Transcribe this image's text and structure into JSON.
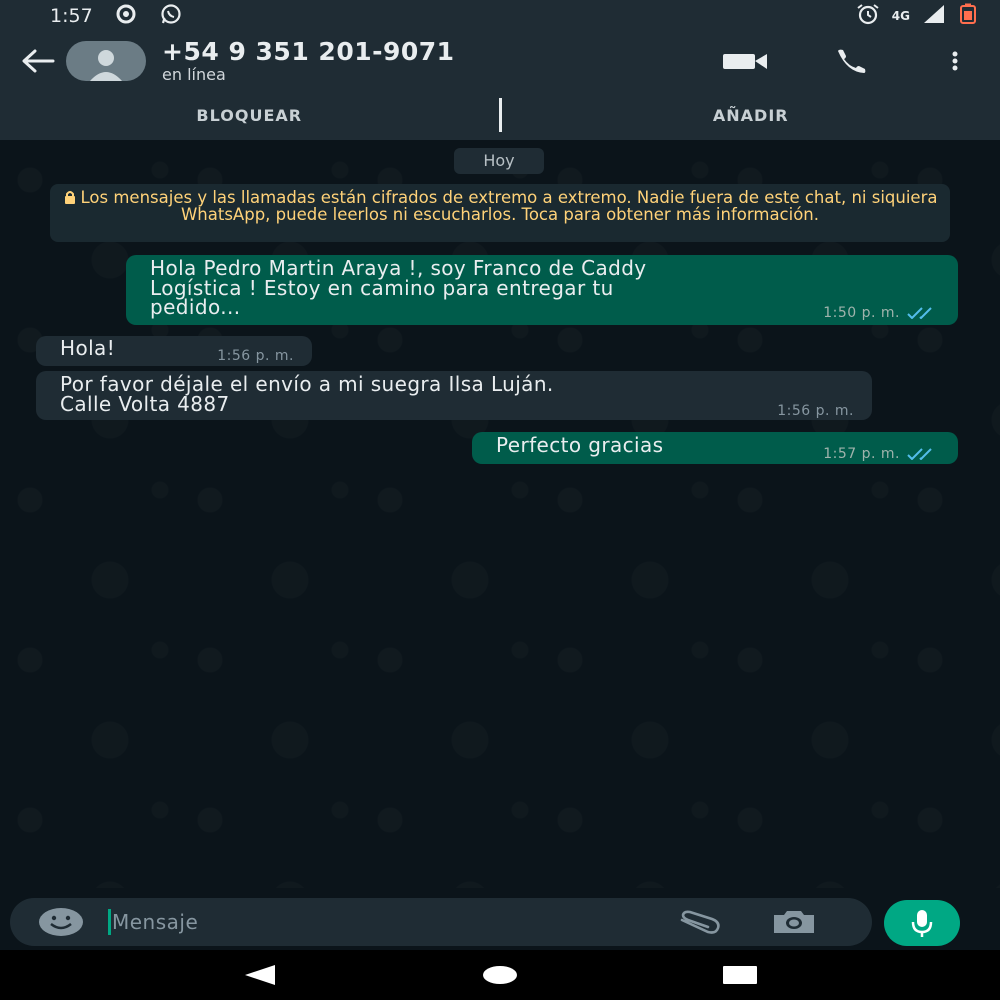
{
  "status_bar": {
    "time": "1:57",
    "network": "4G",
    "icons": [
      "vpn-icon",
      "whatsapp-icon",
      "alarm-icon",
      "signal-icon",
      "battery-icon"
    ]
  },
  "header": {
    "contact_name": "+54 9 351 201-9071",
    "contact_status": "en línea",
    "icons": [
      "back-arrow-icon",
      "avatar-icon",
      "video-call-icon",
      "voice-call-icon",
      "more-options-icon"
    ]
  },
  "actions": {
    "block": "BLOQUEAR",
    "add": "AÑADIR"
  },
  "chat": {
    "date_chip": "Hoy",
    "encryption_notice": "Los mensajes y las llamadas están cifrados de extremo a extremo. Nadie fuera de este chat, ni siquiera WhatsApp, puede leerlos ni escucharlos. Toca para obtener más información.",
    "messages": [
      {
        "direction": "outgoing",
        "lines": [
          "Hola Pedro Martin Araya !, soy Franco de Caddy",
          "Logística ! Estoy en camino para entregar tu",
          "pedido..."
        ],
        "time": "1:50 p. m.",
        "read": true
      },
      {
        "direction": "incoming",
        "lines": [
          "Hola!"
        ],
        "time": "1:56 p. m."
      },
      {
        "direction": "incoming",
        "lines": [
          "Por favor déjale el envío a mi suegra Ilsa Luján.",
          "Calle Volta 4887"
        ],
        "time": "1:56 p. m."
      },
      {
        "direction": "outgoing",
        "lines": [
          "Perfecto gracias"
        ],
        "time": "1:57 p. m.",
        "read": true
      }
    ]
  },
  "composer": {
    "placeholder": "Mensaje",
    "icons": [
      "emoji-icon",
      "attach-icon",
      "camera-icon",
      "mic-icon"
    ]
  },
  "colors": {
    "background": "#0b141a",
    "bar": "#1f2c34",
    "outgoing_bubble": "#005c4b",
    "incoming_bubble": "#1f2c34",
    "accent": "#00a884",
    "notice_text": "#ffd279",
    "read_ticks": "#53bdeb"
  }
}
